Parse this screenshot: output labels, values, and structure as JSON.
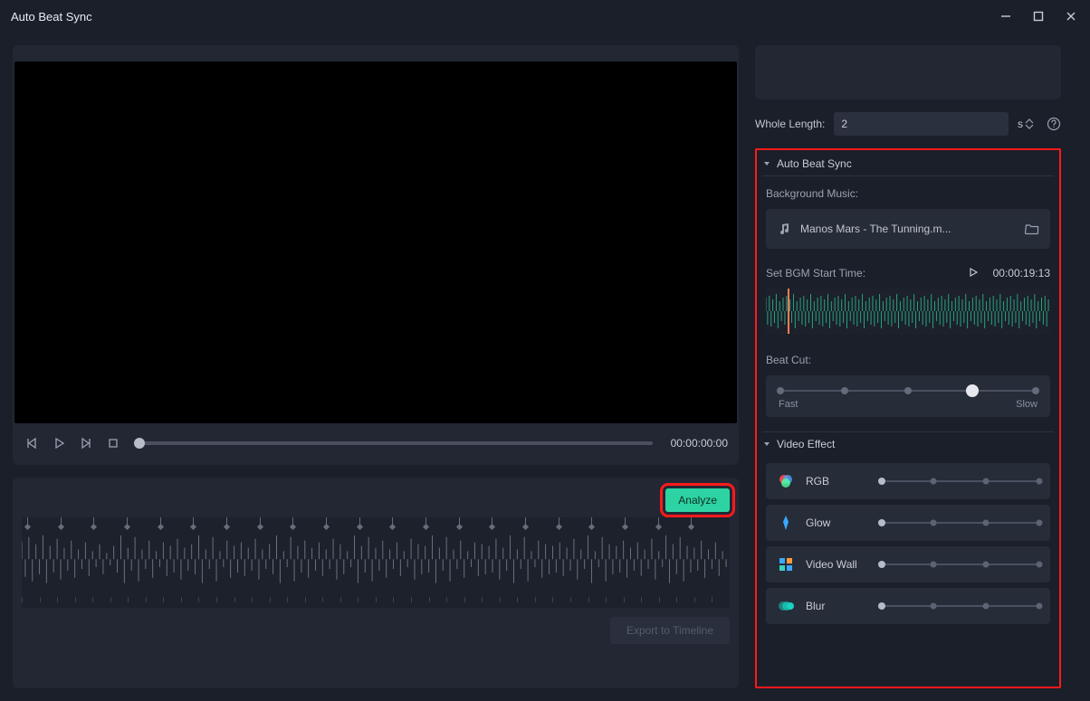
{
  "window": {
    "title": "Auto Beat Sync"
  },
  "player": {
    "timecode": "00:00:00:00"
  },
  "analyze": {
    "label": "Analyze"
  },
  "export": {
    "label": "Export to Timeline"
  },
  "wholeLength": {
    "label": "Whole Length:",
    "value": "2",
    "unit": "s"
  },
  "sections": {
    "autoBeat": {
      "title": "Auto Beat Sync",
      "bgmLabel": "Background Music:",
      "music": "Manos Mars - The Tunning.m...",
      "startLabel": "Set BGM Start Time:",
      "startTc": "00:00:19:13",
      "beatCutLabel": "Beat Cut:",
      "fast": "Fast",
      "slow": "Slow"
    },
    "videoEffect": {
      "title": "Video Effect",
      "effects": [
        {
          "name": "RGB",
          "iconColor": "#ff5a5a"
        },
        {
          "name": "Glow",
          "iconColor": "#3aa8ff"
        },
        {
          "name": "Video Wall",
          "iconColor": "#3aa8ff"
        },
        {
          "name": "Blur",
          "iconColor": "#17d3c0"
        }
      ]
    }
  }
}
